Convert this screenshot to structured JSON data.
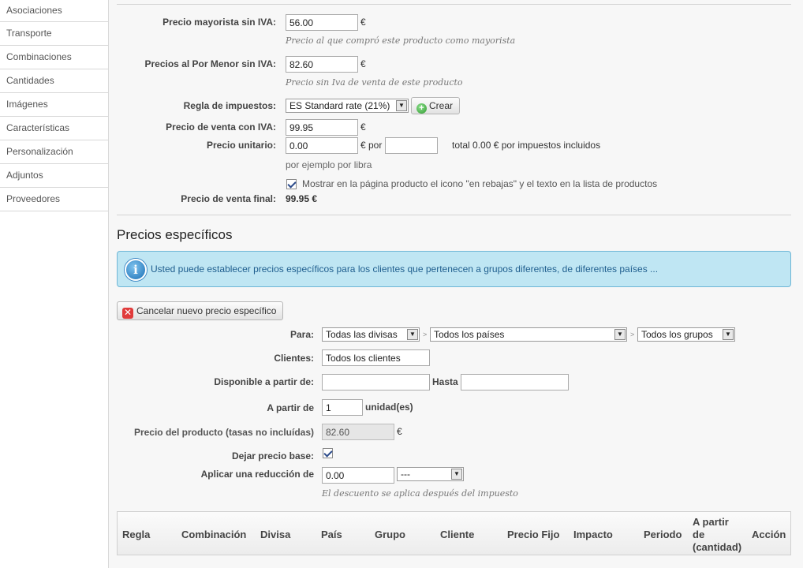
{
  "sidebar": {
    "items": [
      {
        "label": "Asociaciones"
      },
      {
        "label": "Transporte"
      },
      {
        "label": "Combinaciones"
      },
      {
        "label": "Cantidades"
      },
      {
        "label": "Imágenes"
      },
      {
        "label": "Características"
      },
      {
        "label": "Personalización"
      },
      {
        "label": "Adjuntos"
      },
      {
        "label": "Proveedores"
      }
    ]
  },
  "pricing": {
    "wholesale_label": "Precio mayorista sin IVA:",
    "wholesale_value": "56.00",
    "wholesale_currency": "€",
    "wholesale_hint": "Precio al que compró este producto como mayorista",
    "retail_label": "Precios al Por Menor sin IVA:",
    "retail_value": "82.60",
    "retail_currency": "€",
    "retail_hint": "Precio sin Iva de venta de este producto",
    "tax_rule_label": "Regla de impuestos:",
    "tax_rule_value": "ES Standard rate (21%)",
    "create_label": "Crear",
    "sale_price_label": "Precio de venta con IVA:",
    "sale_price_value": "99.95",
    "sale_price_currency": "€",
    "unit_price_label": "Precio unitario:",
    "unit_price_value": "0.00",
    "unit_price_per": "€ por",
    "unit_price_unit_value": "",
    "unit_price_total": "total 0.00 € por impuestos incluidos",
    "unit_price_hint": "por ejemplo por libra",
    "on_sale_label": "Mostrar en la página producto el icono \"en rebajas\" y el texto en la lista de productos",
    "final_price_label": "Precio de venta final:",
    "final_price_value": "99.95 €"
  },
  "specific": {
    "title": "Precios específicos",
    "info": "Usted puede establecer precios específicos para los clientes que pertenecen a grupos diferentes, de diferentes países ...",
    "cancel_label": "Cancelar nuevo precio específico",
    "para_label": "Para:",
    "currency_select": "Todas las divisas",
    "country_select": "Todos los países",
    "group_select": "Todos los grupos",
    "separator": ">",
    "clients_label": "Clientes:",
    "clients_value": "Todos los clientes",
    "available_label": "Disponible a partir de:",
    "from_value": "",
    "until_label": "Hasta",
    "until_value": "",
    "starting_label": "A partir de",
    "starting_value": "1",
    "unit_label": "unidad(es)",
    "product_price_label": "Precio del producto (tasas no incluídas)",
    "product_price_value": "82.60",
    "product_price_currency": "€",
    "leave_base_label": "Dejar precio base:",
    "reduction_label": "Aplicar una reducción de",
    "reduction_value": "0.00",
    "reduction_type": "---",
    "reduction_hint": "El descuento se aplica después del impuesto"
  },
  "table": {
    "headers": [
      "Regla",
      "Combinación",
      "Divisa",
      "País",
      "Grupo",
      "Cliente",
      "Precio Fijo",
      "Impacto",
      "Periodo",
      "A partir de (cantidad)",
      "Acción"
    ],
    "header_lines": [
      "A partir",
      "de",
      "(cantidad)"
    ]
  }
}
